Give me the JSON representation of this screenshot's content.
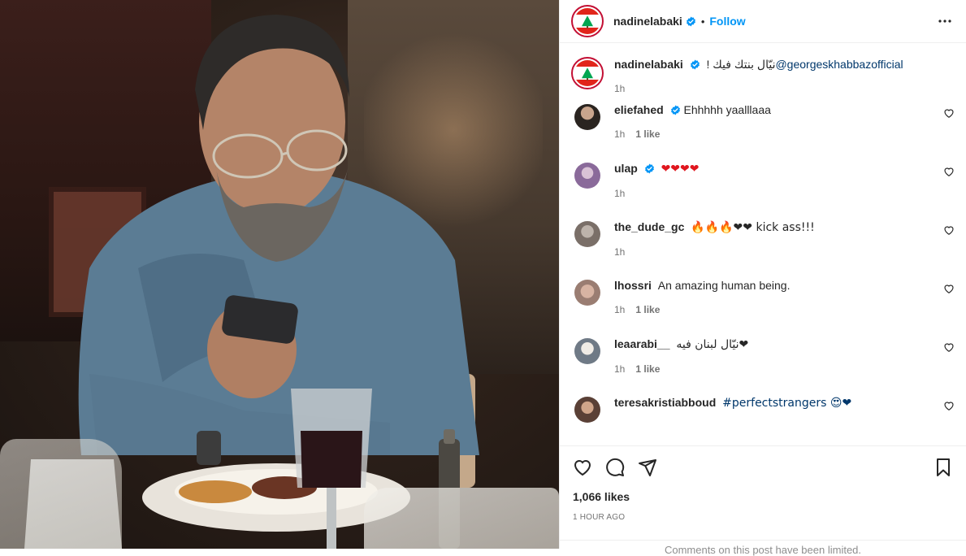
{
  "header": {
    "username": "nadinelabaki",
    "separator": "•",
    "follow_label": "Follow"
  },
  "caption": {
    "username": "nadinelabaki",
    "text": "نيّال بنتك فيك ! ",
    "mention": "@georgeskhabbazofficial",
    "time": "1h"
  },
  "comments": [
    {
      "username": "eliefahed",
      "verified": true,
      "text": "Ehhhhh yaalllaaa",
      "time": "1h",
      "likes": "1 like",
      "avatar_color": "#2a2420"
    },
    {
      "username": "ulap",
      "verified": true,
      "text": "❤❤❤❤",
      "time": "1h",
      "likes": "",
      "avatar_color": "#8a6a9a"
    },
    {
      "username": "the_dude_gc",
      "verified": false,
      "text": "🔥🔥🔥❤❤ kick ass!!!",
      "time": "1h",
      "likes": "",
      "avatar_color": "#7a6f68"
    },
    {
      "username": "lhossri",
      "verified": false,
      "text": "An amazing human being.",
      "time": "1h",
      "likes": "1 like",
      "avatar_color": "#9a7d72"
    },
    {
      "username": "leaarabi__",
      "verified": false,
      "text": "❤نيّال لبنان فيه",
      "time": "1h",
      "likes": "1 like",
      "avatar_color": "#6f7a86"
    },
    {
      "username": "teresakristiabboud",
      "verified": false,
      "text": "#perfectstrangers 😍❤",
      "time": "",
      "likes": "",
      "avatar_color": "#5a4036"
    }
  ],
  "actions": {
    "likes": "1,066 likes",
    "timestamp": "1 HOUR AGO",
    "limited_notice": "Comments on this post have been limited."
  },
  "icons": [
    "like-icon",
    "comment-icon",
    "share-icon",
    "save-icon",
    "more-options-icon",
    "verified-badge-icon",
    "comment-like-icon"
  ],
  "colors": {
    "link": "#0095f6",
    "verified": "#0095f6",
    "heart": "#e0161e",
    "flag_red": "#e1251b",
    "cedar_green": "#00a651"
  }
}
